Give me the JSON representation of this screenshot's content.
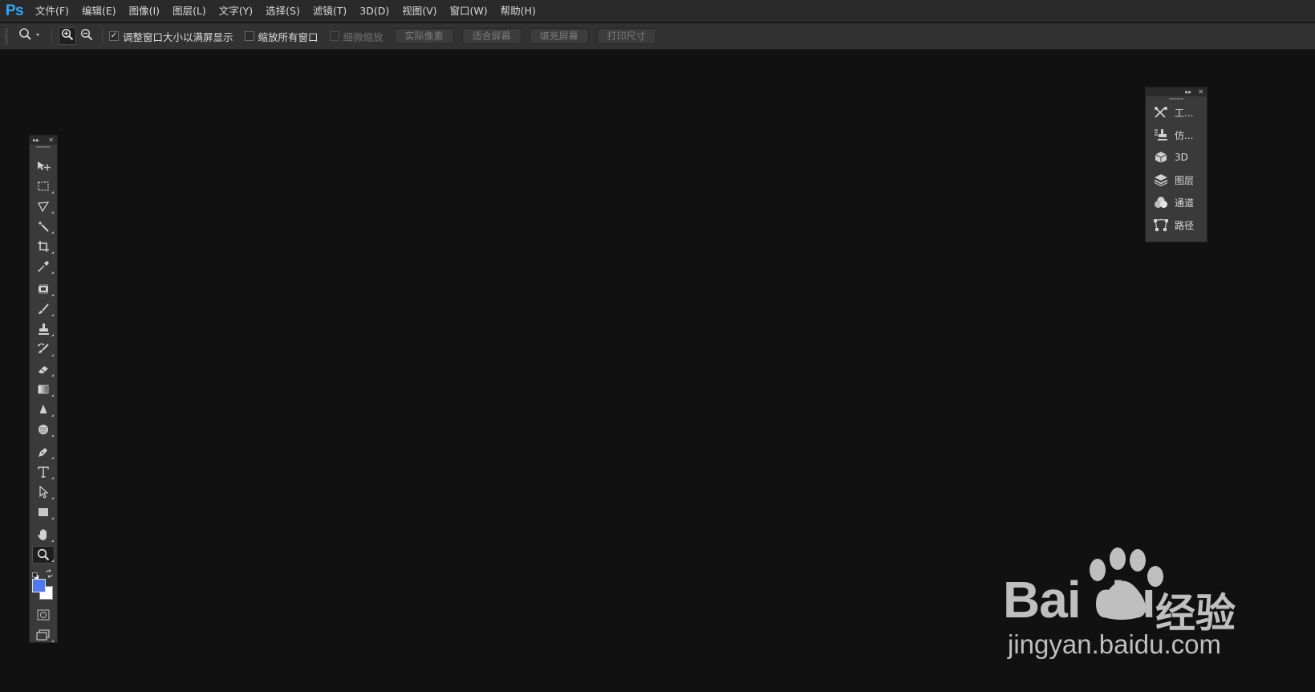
{
  "app": {
    "logo": "Ps"
  },
  "menu": [
    {
      "label": "文件(F)"
    },
    {
      "label": "编辑(E)"
    },
    {
      "label": "图像(I)"
    },
    {
      "label": "图层(L)"
    },
    {
      "label": "文字(Y)"
    },
    {
      "label": "选择(S)"
    },
    {
      "label": "滤镜(T)"
    },
    {
      "label": "3D(D)"
    },
    {
      "label": "视图(V)"
    },
    {
      "label": "窗口(W)"
    },
    {
      "label": "帮助(H)"
    }
  ],
  "options": {
    "resize_windows": {
      "label": "调整窗口大小以满屏显示",
      "checked": true,
      "mark": "✓"
    },
    "zoom_all_windows": {
      "label": "缩放所有窗口",
      "checked": false
    },
    "scrubby_zoom": {
      "label": "细微缩放",
      "checked": false,
      "disabled": true
    },
    "buttons": {
      "actual_pixels": "实际像素",
      "fit_screen": "适合屏幕",
      "fill_screen": "填充屏幕",
      "print_size": "打印尺寸"
    }
  },
  "panel_controls": {
    "collapse": "▸▸",
    "close": "✕"
  },
  "toolbox": {
    "tools": [
      {
        "icon": "move-tool-icon"
      },
      {
        "icon": "rectangular-marquee-icon"
      },
      {
        "icon": "lasso-icon"
      },
      {
        "icon": "magic-wand-icon"
      },
      {
        "icon": "crop-icon"
      },
      {
        "icon": "eyedropper-icon"
      },
      {
        "icon": "healing-brush-icon"
      },
      {
        "icon": "brush-icon"
      },
      {
        "icon": "clone-stamp-icon"
      },
      {
        "icon": "history-brush-icon"
      },
      {
        "icon": "eraser-icon"
      },
      {
        "icon": "gradient-icon"
      },
      {
        "icon": "blur-icon"
      },
      {
        "icon": "dodge-icon"
      },
      {
        "icon": "pen-icon"
      },
      {
        "icon": "type-icon"
      },
      {
        "icon": "path-selection-icon"
      },
      {
        "icon": "rectangle-shape-icon"
      },
      {
        "icon": "hand-icon"
      },
      {
        "icon": "zoom-icon",
        "selected": true
      }
    ],
    "foreground_color": "#4f79f0",
    "background_color": "#ffffff"
  },
  "dock": {
    "items": [
      {
        "label": "工...",
        "icon": "tool-presets-icon"
      },
      {
        "label": "仿...",
        "icon": "clone-source-icon"
      },
      {
        "label": "3D",
        "icon": "3d-cube-icon"
      },
      {
        "label": "图层",
        "icon": "layers-icon"
      },
      {
        "label": "通道",
        "icon": "channels-icon"
      },
      {
        "label": "路径",
        "icon": "paths-icon"
      }
    ]
  },
  "watermark": {
    "brand": "Bai du",
    "cn": "经验",
    "url": "jingyan.baidu.com"
  }
}
